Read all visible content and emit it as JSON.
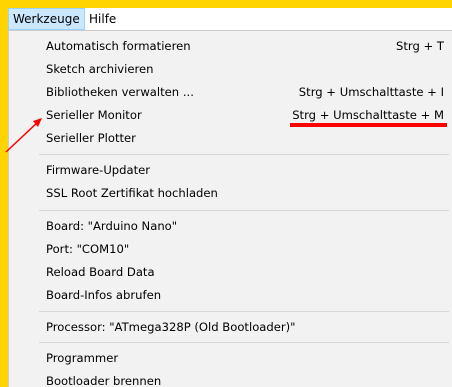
{
  "menubar": {
    "items": [
      {
        "label": "Werkzeuge"
      },
      {
        "label": "Hilfe"
      }
    ]
  },
  "menu": {
    "items": [
      {
        "label": "Automatisch formatieren",
        "shortcut": "Strg + T"
      },
      {
        "label": "Sketch archivieren",
        "shortcut": ""
      },
      {
        "label": "Bibliotheken verwalten ...",
        "shortcut": "Strg + Umschalttaste + I"
      },
      {
        "label": "Serieller Monitor",
        "shortcut": "Strg + Umschalttaste + M"
      },
      {
        "label": "Serieller Plotter",
        "shortcut": ""
      },
      {
        "label": "Firmware-Updater",
        "shortcut": ""
      },
      {
        "label": "SSL Root Zertifikat hochladen",
        "shortcut": ""
      },
      {
        "label": "Board: \"Arduino Nano\"",
        "shortcut": ""
      },
      {
        "label": "Port: \"COM10\"",
        "shortcut": ""
      },
      {
        "label": "Reload Board Data",
        "shortcut": ""
      },
      {
        "label": "Board-Infos abrufen",
        "shortcut": ""
      },
      {
        "label": "Processor: \"ATmega328P (Old Bootloader)\"",
        "shortcut": ""
      },
      {
        "label": "Programmer",
        "shortcut": ""
      },
      {
        "label": "Bootloader brennen",
        "shortcut": ""
      }
    ]
  },
  "annotation": {
    "underline_color": "#ff0000",
    "arrow_color": "#ff0000",
    "border_color": "#ffd400"
  }
}
